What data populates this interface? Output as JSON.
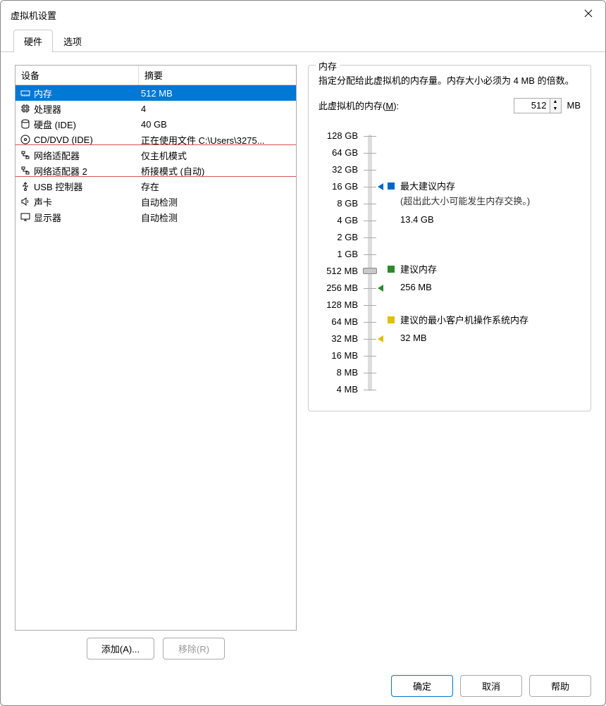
{
  "window_title": "虚拟机设置",
  "tabs": {
    "hardware": "硬件",
    "options": "选项"
  },
  "table_headers": {
    "device": "设备",
    "summary": "摘要"
  },
  "devices": [
    {
      "name": "内存",
      "summary": "512 MB",
      "icon": "memory"
    },
    {
      "name": "处理器",
      "summary": "4",
      "icon": "cpu"
    },
    {
      "name": "硬盘 (IDE)",
      "summary": "40 GB",
      "icon": "disk"
    },
    {
      "name": "CD/DVD (IDE)",
      "summary": "正在使用文件 C:\\Users\\3275...",
      "icon": "cd"
    },
    {
      "name": "网络适配器",
      "summary": "仅主机模式",
      "icon": "net"
    },
    {
      "name": "网络适配器 2",
      "summary": "桥接模式 (自动)",
      "icon": "net"
    },
    {
      "name": "USB 控制器",
      "summary": "存在",
      "icon": "usb"
    },
    {
      "name": "声卡",
      "summary": "自动检测",
      "icon": "sound"
    },
    {
      "name": "显示器",
      "summary": "自动检测",
      "icon": "display"
    }
  ],
  "buttons": {
    "add": "添加(A)...",
    "remove": "移除(R)",
    "ok": "确定",
    "cancel": "取消",
    "help": "帮助"
  },
  "memory": {
    "group_title": "内存",
    "desc": "指定分配给此虚拟机的内存量。内存大小必须为 4 MB 的倍数。",
    "input_label_pre": "此虚拟机的内存(",
    "input_label_mnemonic": "M",
    "input_label_post": "):",
    "input_value": "512",
    "unit": "MB",
    "ticks": [
      "128 GB",
      "64 GB",
      "32 GB",
      "16 GB",
      "8 GB",
      "4 GB",
      "2 GB",
      "1 GB",
      "512 MB",
      "256 MB",
      "128 MB",
      "64 MB",
      "32 MB",
      "16 MB",
      "8 MB",
      "4 MB"
    ],
    "legends": {
      "max": {
        "title": "最大建议内存",
        "sub": "(超出此大小可能发生内存交换。)",
        "value": "13.4 GB"
      },
      "rec": {
        "title": "建议内存",
        "value": "256 MB"
      },
      "min": {
        "title": "建议的最小客户机操作系统内存",
        "value": "32 MB"
      }
    }
  }
}
